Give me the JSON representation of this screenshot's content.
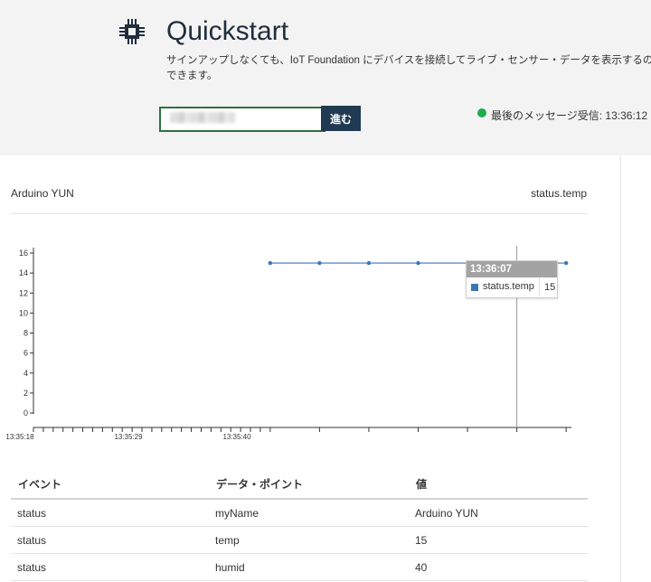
{
  "header": {
    "title": "Quickstart",
    "description": "サインアップしなくても、IoT Foundation にデバイスを接続してライブ・センサー・データを表示するのできます。",
    "device_input_value": "",
    "go_button_label": "進む",
    "status_text": "最後のメッセージ受信: 13:36:12",
    "status_color": "#1cae4a"
  },
  "panel": {
    "device_name": "Arduino YUN",
    "series_name": "status.temp"
  },
  "chart_data": {
    "type": "line",
    "title": "",
    "xlabel": "",
    "ylabel": "",
    "ylim": [
      0,
      16
    ],
    "y_ticks": [
      0,
      2,
      4,
      6,
      8,
      10,
      12,
      14,
      16
    ],
    "x_tick_labels": [
      "13:35:18",
      "13:35:29",
      "13:35:40"
    ],
    "series": [
      {
        "name": "status.temp",
        "color": "#3a78b5",
        "x": [
          "13:35:42",
          "13:35:47",
          "13:35:52",
          "13:35:57",
          "13:36:02",
          "13:36:07",
          "13:36:12"
        ],
        "values": [
          15,
          15,
          15,
          15,
          15,
          15,
          15
        ]
      }
    ],
    "tooltip": {
      "time": "13:36:07",
      "label": "status.temp",
      "value": "15"
    }
  },
  "table": {
    "headers": [
      "イベント",
      "データ・ポイント",
      "値"
    ],
    "rows": [
      [
        "status",
        "myName",
        "Arduino YUN"
      ],
      [
        "status",
        "temp",
        "15"
      ],
      [
        "status",
        "humid",
        "40"
      ]
    ]
  }
}
